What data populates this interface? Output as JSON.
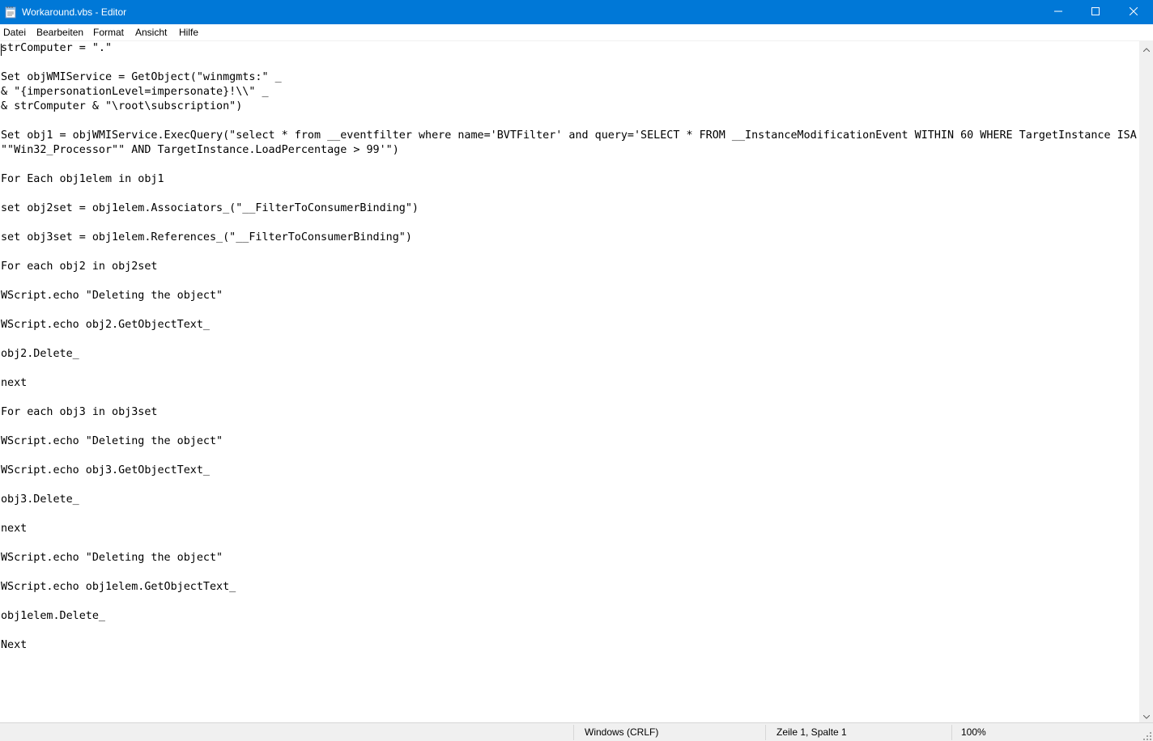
{
  "window": {
    "title": "Workaround.vbs - Editor",
    "accent_color": "#0078d7",
    "icons": {
      "app": "notepad-icon",
      "minimize": "minimize-icon",
      "maximize": "maximize-icon",
      "close": "close-icon"
    }
  },
  "menu": {
    "items": [
      "Datei",
      "Bearbeiten",
      "Format",
      "Ansicht",
      "Hilfe"
    ]
  },
  "editor": {
    "lines": [
      "strComputer = \".\"",
      "",
      "Set objWMIService = GetObject(\"winmgmts:\" _",
      "& \"{impersonationLevel=impersonate}!\\\\\" _",
      "& strComputer & \"\\root\\subscription\")",
      "",
      "Set obj1 = objWMIService.ExecQuery(\"select * from __eventfilter where name='BVTFilter' and query='SELECT * FROM __InstanceModificationEvent WITHIN 60 WHERE TargetInstance ISA",
      "\"\"Win32_Processor\"\" AND TargetInstance.LoadPercentage > 99'\")",
      "",
      "For Each obj1elem in obj1",
      "",
      "set obj2set = obj1elem.Associators_(\"__FilterToConsumerBinding\")",
      "",
      "set obj3set = obj1elem.References_(\"__FilterToConsumerBinding\")",
      "",
      "For each obj2 in obj2set",
      "",
      "WScript.echo \"Deleting the object\"",
      "",
      "WScript.echo obj2.GetObjectText_",
      "",
      "obj2.Delete_",
      "",
      "next",
      "",
      "For each obj3 in obj3set",
      "",
      "WScript.echo \"Deleting the object\"",
      "",
      "WScript.echo obj3.GetObjectText_",
      "",
      "obj3.Delete_",
      "",
      "next",
      "",
      "WScript.echo \"Deleting the object\"",
      "",
      "WScript.echo obj1elem.GetObjectText_",
      "",
      "obj1elem.Delete_",
      "",
      "Next"
    ]
  },
  "statusbar": {
    "encoding": "Windows (CRLF)",
    "position": "Zeile 1, Spalte 1",
    "zoom": "100%"
  }
}
